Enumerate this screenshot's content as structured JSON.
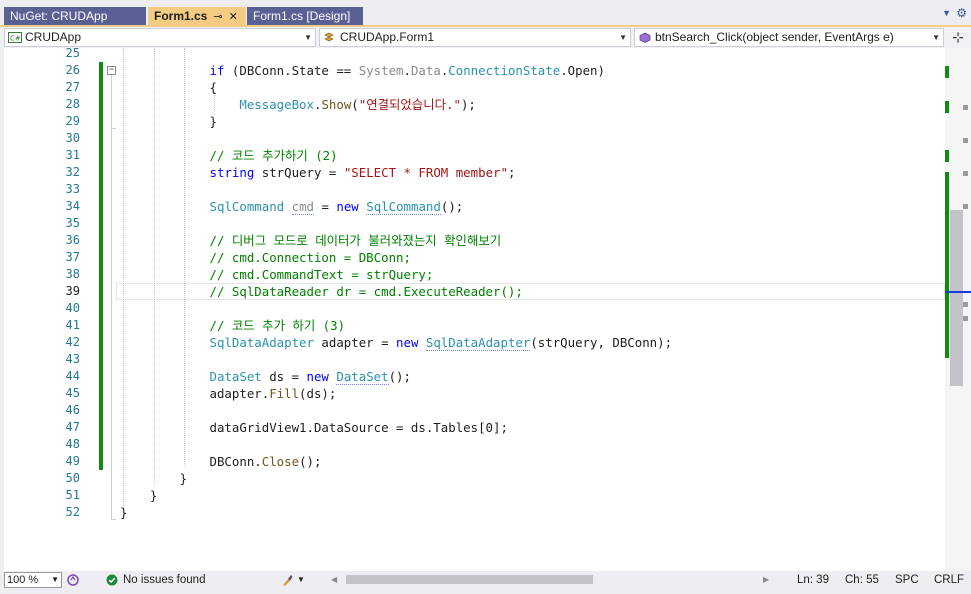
{
  "tabs": [
    {
      "label": "NuGet: CRUDApp",
      "active": false
    },
    {
      "label": "Form1.cs",
      "active": true,
      "pin": "⊸",
      "close": "✕"
    },
    {
      "label": "Form1.cs [Design]",
      "active": false
    }
  ],
  "tab_overflow_icon": "chevron-down-icon",
  "tab_settings_icon": "gear-icon",
  "navbar": {
    "project": "CRUDApp",
    "class": "CRUDApp.Form1",
    "member": "btnSearch_Click(object sender, EventArgs e)"
  },
  "code_lines": [
    {
      "num": "25",
      "html": ""
    },
    {
      "num": "26",
      "html": "            <span class=\"kw\">if</span> (DBConn.State == <span class=\"gr\">System</span>.<span class=\"gr\">Data</span>.<span class=\"ty\">ConnectionState</span>.Open)"
    },
    {
      "num": "27",
      "html": "            {"
    },
    {
      "num": "28",
      "html": "                <span class=\"ty\">MessageBox</span>.<span class=\"mt\">Show</span>(<span class=\"st\">\"연결되었습니다.\"</span>);"
    },
    {
      "num": "29",
      "html": "            }"
    },
    {
      "num": "30",
      "html": ""
    },
    {
      "num": "31",
      "html": "            <span class=\"cm\">// 코드 추가하기 (2)</span>"
    },
    {
      "num": "32",
      "html": "            <span class=\"kw\">string</span> strQuery = <span class=\"st\">\"SELECT * FROM member\"</span>;"
    },
    {
      "num": "33",
      "html": ""
    },
    {
      "num": "34",
      "html": "            <span class=\"ty\">SqlCommand</span> <span class=\"gr uw\">cmd</span> = <span class=\"kw\">new</span> <span class=\"ty uw\">SqlCommand</span>();"
    },
    {
      "num": "35",
      "html": ""
    },
    {
      "num": "36",
      "html": "            <span class=\"cm\">// 디버그 모드로 데이터가 불러와졌는지 확인해보기</span>"
    },
    {
      "num": "37",
      "html": "            <span class=\"cm\">// cmd.Connection = DBConn;</span>"
    },
    {
      "num": "38",
      "html": "            <span class=\"cm\">// cmd.CommandText = strQuery;</span>"
    },
    {
      "num": "39",
      "html": "            <span class=\"cm\">// SqlDataReader dr = cmd.ExecuteReader();</span>"
    },
    {
      "num": "40",
      "html": ""
    },
    {
      "num": "41",
      "html": "            <span class=\"cm\">// 코드 추가 하기 (3)</span>"
    },
    {
      "num": "42",
      "html": "            <span class=\"ty\">SqlDataAdapter</span> adapter = <span class=\"kw\">new</span> <span class=\"ty uw\">SqlDataAdapter</span>(strQuery, DBConn);"
    },
    {
      "num": "43",
      "html": ""
    },
    {
      "num": "44",
      "html": "            <span class=\"ty\">DataSet</span> ds = <span class=\"kw\">new</span> <span class=\"ty uw\">DataSet</span>();"
    },
    {
      "num": "45",
      "html": "            adapter.<span class=\"mt\">Fill</span>(ds);"
    },
    {
      "num": "46",
      "html": ""
    },
    {
      "num": "47",
      "html": "            dataGridView1.DataSource = ds.Tables[0];"
    },
    {
      "num": "48",
      "html": ""
    },
    {
      "num": "49",
      "html": "            DBConn.<span class=\"mt\">Close</span>();"
    },
    {
      "num": "50",
      "html": "        }"
    },
    {
      "num": "51",
      "html": "    }"
    },
    {
      "num": "52",
      "html": "}"
    }
  ],
  "current_line": "39",
  "status": {
    "zoom": "100 %",
    "issues": "No issues found",
    "ln": "Ln: 39",
    "ch": "Ch: 55",
    "ws": "SPC",
    "eol": "CRLF"
  },
  "colors": {
    "accent_tab": "#f5cc84",
    "inactive_tab": "#5a5f94",
    "changed_bar": "#108a10",
    "keyword": "#0000ff",
    "type": "#2b91af",
    "comment": "#008000",
    "string": "#a31515"
  }
}
